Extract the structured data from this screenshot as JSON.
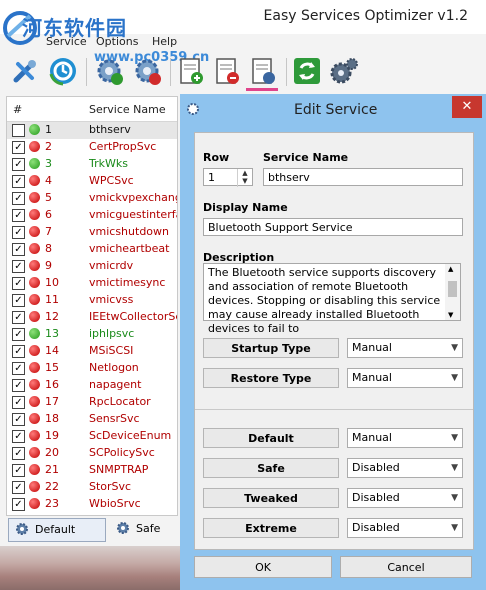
{
  "app": {
    "title": "Easy Services Optimizer v1.2",
    "watermark": "河东软件园",
    "watermark_url": "www.pc0359.cn"
  },
  "menu": [
    "Service",
    "Options",
    "Help"
  ],
  "toolbar": [
    {
      "name": "tools-icon"
    },
    {
      "name": "restore-icon"
    },
    {
      "name": "apply-icon"
    },
    {
      "name": "stop-icon"
    },
    {
      "name": "add-service-icon"
    },
    {
      "name": "remove-service-icon"
    },
    {
      "name": "edit-service-icon"
    },
    {
      "name": "refresh-icon"
    },
    {
      "name": "settings-icon"
    }
  ],
  "list": {
    "col_num": "#",
    "col_name": "Service Name",
    "rows": [
      {
        "num": "1",
        "name": "bthserv",
        "status": "green",
        "checked": false,
        "color": "black"
      },
      {
        "num": "2",
        "name": "CertPropSvc",
        "status": "red",
        "checked": true,
        "color": "red"
      },
      {
        "num": "3",
        "name": "TrkWks",
        "status": "green",
        "checked": true,
        "color": "green"
      },
      {
        "num": "4",
        "name": "WPCSvc",
        "status": "red",
        "checked": true,
        "color": "red"
      },
      {
        "num": "5",
        "name": "vmickvpexchange",
        "status": "red",
        "checked": true,
        "color": "red"
      },
      {
        "num": "6",
        "name": "vmicguestinterface",
        "status": "red",
        "checked": true,
        "color": "red"
      },
      {
        "num": "7",
        "name": "vmicshutdown",
        "status": "red",
        "checked": true,
        "color": "red"
      },
      {
        "num": "8",
        "name": "vmicheartbeat",
        "status": "red",
        "checked": true,
        "color": "red"
      },
      {
        "num": "9",
        "name": "vmicrdv",
        "status": "red",
        "checked": true,
        "color": "red"
      },
      {
        "num": "10",
        "name": "vmictimesync",
        "status": "red",
        "checked": true,
        "color": "red"
      },
      {
        "num": "11",
        "name": "vmicvss",
        "status": "red",
        "checked": true,
        "color": "red"
      },
      {
        "num": "12",
        "name": "IEEtwCollectorService",
        "status": "red",
        "checked": true,
        "color": "red"
      },
      {
        "num": "13",
        "name": "iphlpsvc",
        "status": "green",
        "checked": true,
        "color": "green"
      },
      {
        "num": "14",
        "name": "MSiSCSI",
        "status": "red",
        "checked": true,
        "color": "red"
      },
      {
        "num": "15",
        "name": "Netlogon",
        "status": "red",
        "checked": true,
        "color": "red"
      },
      {
        "num": "16",
        "name": "napagent",
        "status": "red",
        "checked": true,
        "color": "red"
      },
      {
        "num": "17",
        "name": "RpcLocator",
        "status": "red",
        "checked": true,
        "color": "red"
      },
      {
        "num": "18",
        "name": "SensrSvc",
        "status": "red",
        "checked": true,
        "color": "red"
      },
      {
        "num": "19",
        "name": "ScDeviceEnum",
        "status": "red",
        "checked": true,
        "color": "red"
      },
      {
        "num": "20",
        "name": "SCPolicySvc",
        "status": "red",
        "checked": true,
        "color": "red"
      },
      {
        "num": "21",
        "name": "SNMPTRAP",
        "status": "red",
        "checked": true,
        "color": "red"
      },
      {
        "num": "22",
        "name": "StorSvc",
        "status": "red",
        "checked": true,
        "color": "red"
      },
      {
        "num": "23",
        "name": "WbioSrvc",
        "status": "red",
        "checked": true,
        "color": "red"
      }
    ]
  },
  "profiles": {
    "default": "Default",
    "safe": "Safe"
  },
  "dialog": {
    "title": "Edit Service",
    "close": "✕",
    "row_label": "Row",
    "row_value": "1",
    "service_name_label": "Service Name",
    "service_name_value": "bthserv",
    "display_name_label": "Display Name",
    "display_name_value": "Bluetooth Support Service",
    "description_label": "Description",
    "description_text": "The Bluetooth service supports discovery and association of remote Bluetooth devices. Stopping or disabling this service may cause already installed Bluetooth devices to fail to",
    "startup_type_label": "Startup Type",
    "startup_type_value": "Manual",
    "restore_type_label": "Restore Type",
    "restore_type_value": "Manual",
    "default_label": "Default",
    "default_value": "Manual",
    "safe_label": "Safe",
    "safe_value": "Disabled",
    "tweaked_label": "Tweaked",
    "tweaked_value": "Disabled",
    "extreme_label": "Extreme",
    "extreme_value": "Disabled",
    "ok": "OK",
    "cancel": "Cancel"
  },
  "colors": {
    "accent": "#8ec3ee",
    "close": "#c7372f",
    "running": "#249a1a",
    "stopped": "#c00000"
  }
}
